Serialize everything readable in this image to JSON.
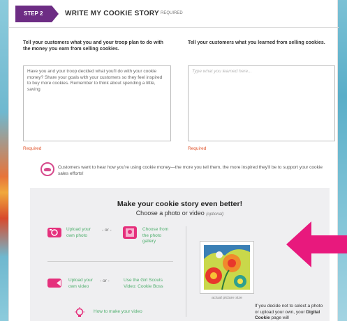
{
  "step": {
    "badge": "STEP 2",
    "title": "WRITE MY COOKIE STORY",
    "required_tag": "REQUIRED"
  },
  "left_field": {
    "prompt": "Tell your customers what you and your troop plan to do with the money you earn from selling cookies.",
    "value": "Have you and your troop decided what you'll do with your cookie money? Share your goals with your customers so they feel inspired to buy more cookies. Remember to think about spending a little, saving",
    "required_label": "Required"
  },
  "right_field": {
    "prompt": "Tell your customers what you learned from selling cookies.",
    "placeholder": "Type what you learned here...",
    "required_label": "Required"
  },
  "info": {
    "text": "Customers want to hear how you're using cookie money—the more you tell them, the more inspired they'll be to support your cookie sales efforts!"
  },
  "story_box": {
    "title": "Make your cookie story even better!",
    "subtitle": "Choose a photo or video",
    "optional": "(optional)",
    "upload_photo": "Upload your own photo",
    "or1": "- or -",
    "choose_gallery": "Choose from the photo gallery",
    "upload_video": "Upload your own video",
    "or2": "- or -",
    "use_video": "Use the Girl Scouts Video: Cookie Boss",
    "how_to_video": "How to make your video",
    "sample_caption": "actual picture size",
    "note_prefix": "If you decide not to select a photo or upload your own, your ",
    "note_bold": "Digital Cookie",
    "note_suffix": " page will"
  },
  "colors": {
    "step_purple": "#6d2d84",
    "required_orange": "#e0532a",
    "link_green": "#4cae6b",
    "icon_pink": "#e5307c",
    "arrow_pink": "#e8197d"
  }
}
